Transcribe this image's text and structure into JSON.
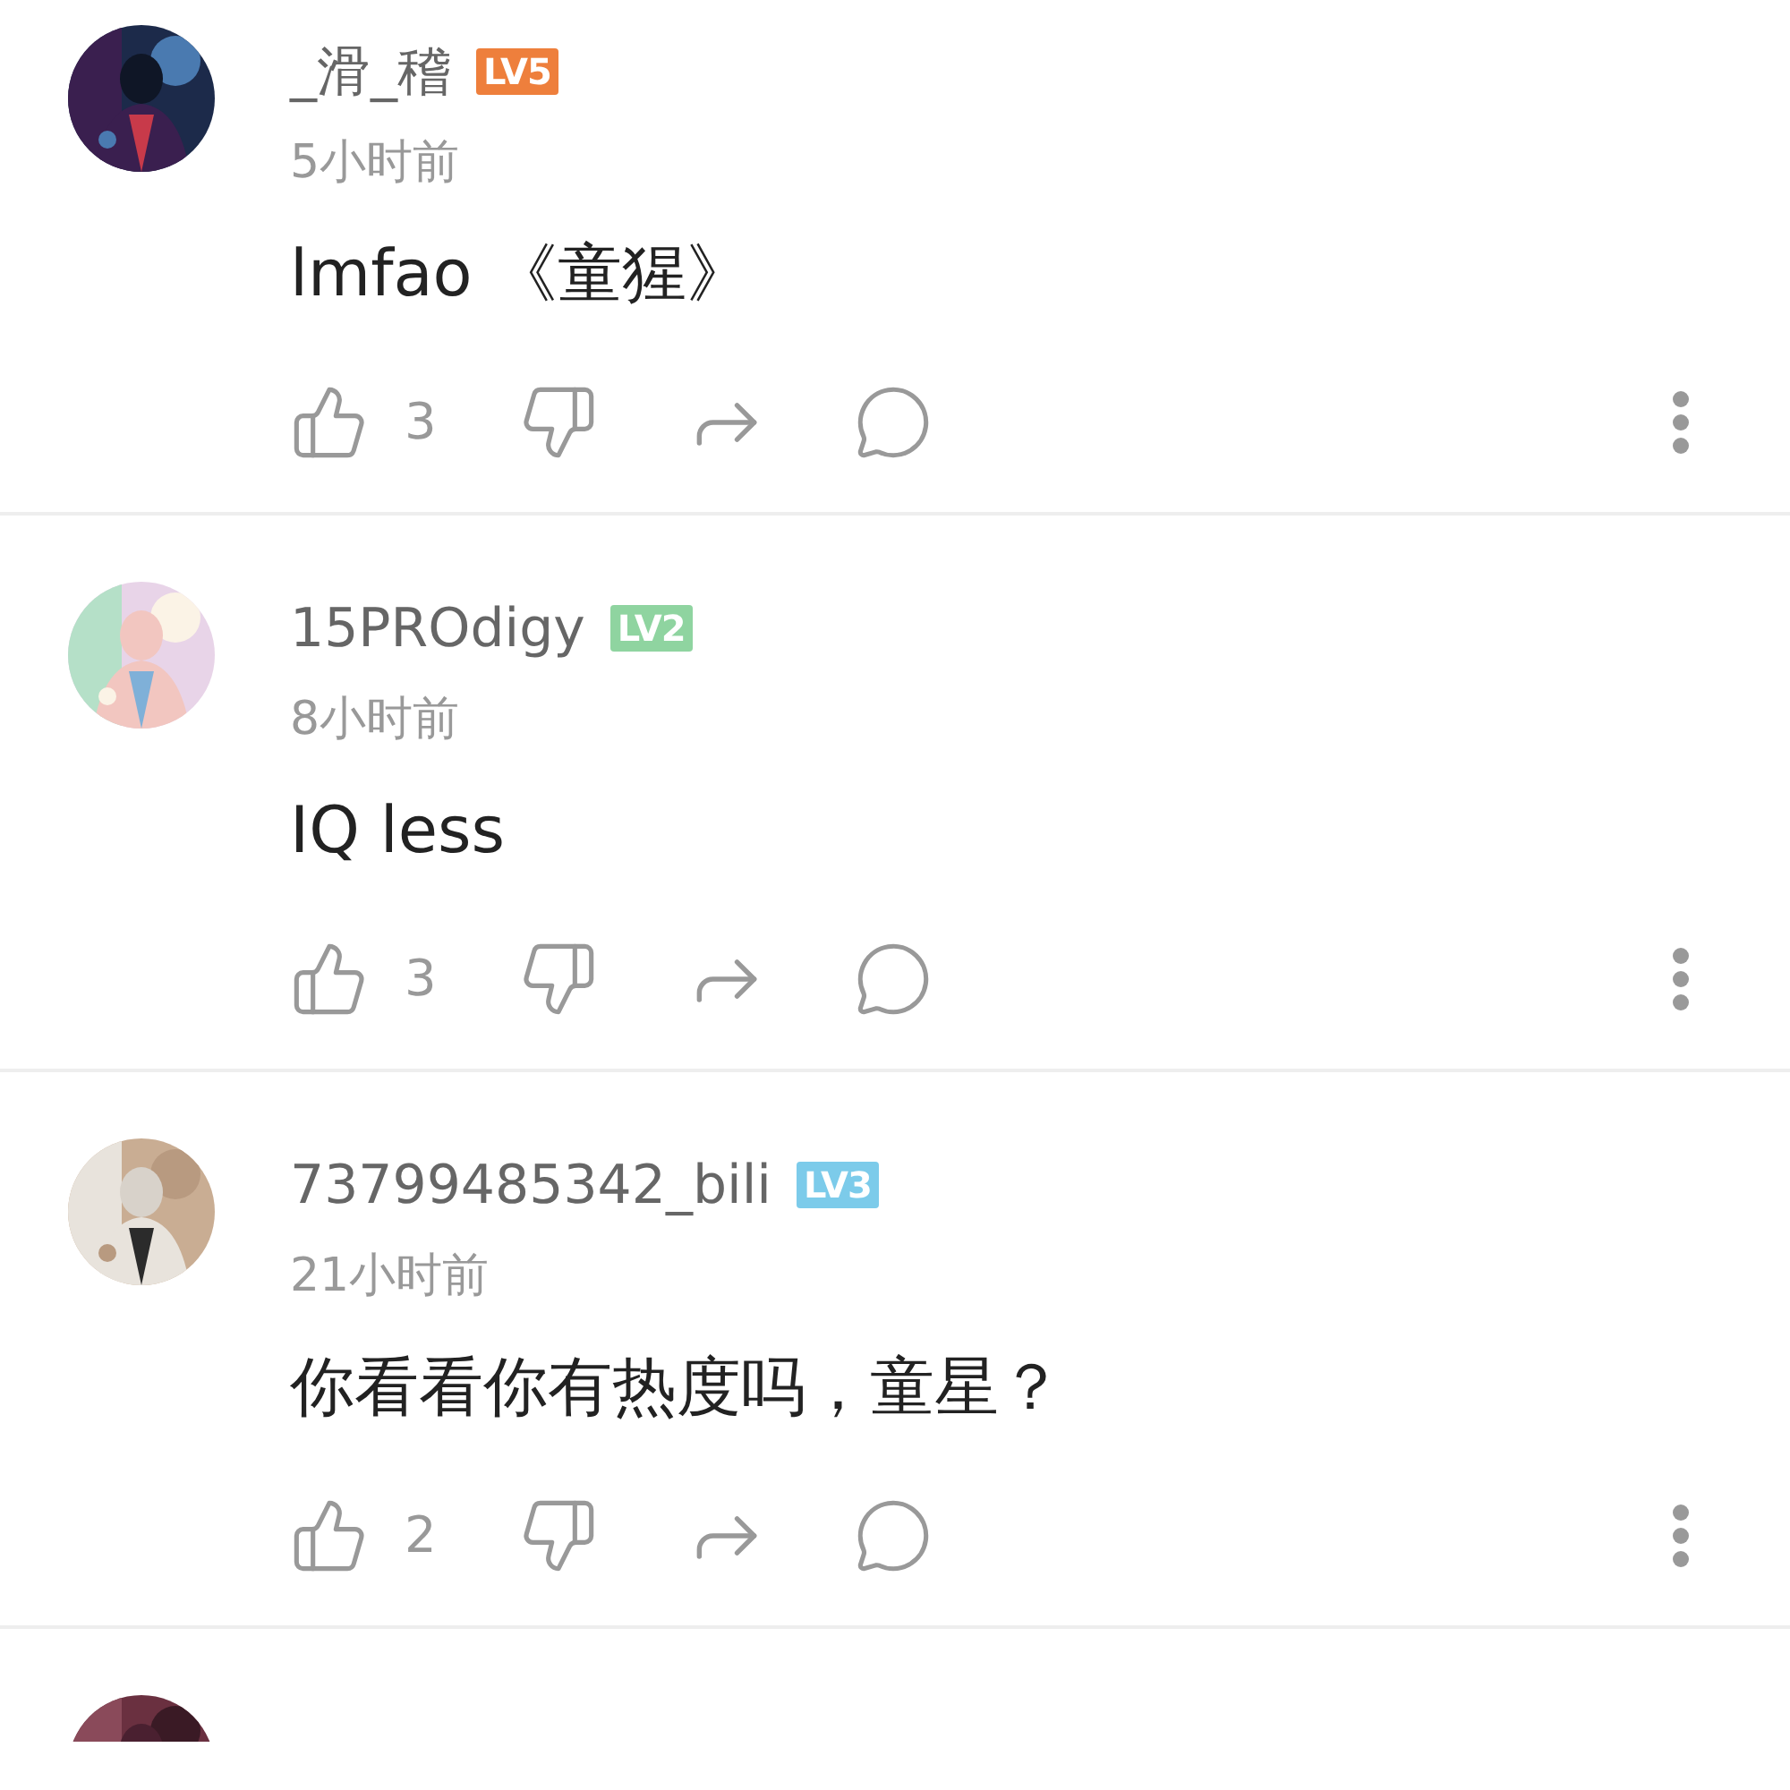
{
  "comments": [
    {
      "username": "_滑_稽",
      "level": "LV5",
      "color": "#ee7f3c",
      "time": "5小时前",
      "text": "lmfao 《童猩》",
      "likes": "3"
    },
    {
      "username": "15PROdigy",
      "level": "LV2",
      "color": "#8fd4a0",
      "time": "8小时前",
      "text": "IQ less",
      "likes": "3"
    },
    {
      "username": "73799485342_bili",
      "level": "LV3",
      "color": "#7ccbea",
      "time": "21小时前",
      "text": "你看看你有热度吗，童星？",
      "likes": "2"
    }
  ]
}
